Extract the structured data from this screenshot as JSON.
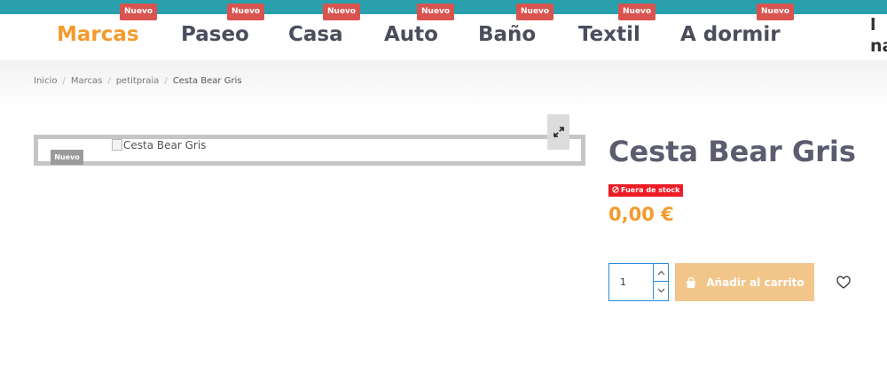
{
  "nav": {
    "items": [
      {
        "label": "Marcas",
        "badge": "Nuevo",
        "active": true
      },
      {
        "label": "Paseo",
        "badge": "Nuevo"
      },
      {
        "label": "Casa",
        "badge": "Nuevo"
      },
      {
        "label": "Auto",
        "badge": "Nuevo"
      },
      {
        "label": "Baño",
        "badge": "Nuevo"
      },
      {
        "label": "Textil",
        "badge": "Nuevo"
      },
      {
        "label": "A dormir",
        "badge": "Nuevo"
      }
    ],
    "cut_item": "l\nna"
  },
  "breadcrumb": [
    "Inicio",
    "Marcas",
    "petitpraia",
    "Cesta Bear Gris"
  ],
  "product": {
    "image_badge": "Nuevo",
    "image_alt": "Cesta Bear Gris",
    "title": "Cesta Bear Gris",
    "stock_label": "Fuera de stock",
    "price": "0,00 €",
    "quantity": "1",
    "add_to_cart": "Añadir al carrito"
  },
  "colors": {
    "top_bar": "#2ba0ad",
    "accent": "#f39a2c",
    "new_badge": "#d9534f",
    "stock_badge": "#ee1c25",
    "cart_button": "#f2c68a"
  },
  "icons": [
    "expand-icon",
    "shopping-bag-icon",
    "heart-icon",
    "block-icon",
    "chevron-up-icon",
    "chevron-down-icon"
  ]
}
